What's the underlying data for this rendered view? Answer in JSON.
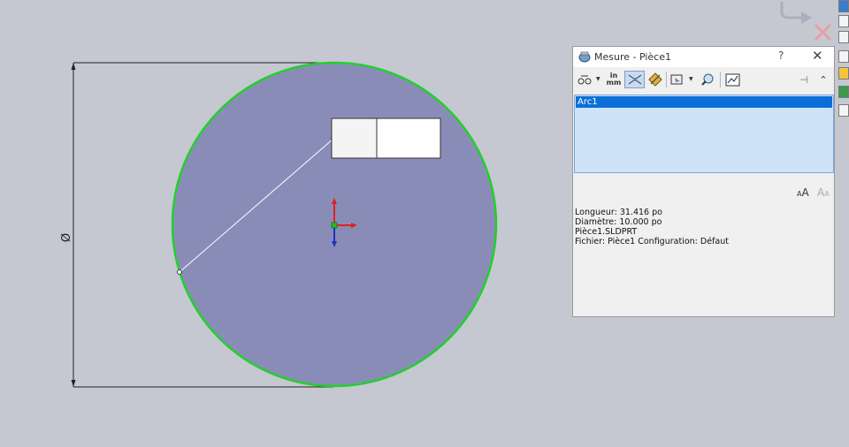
{
  "sketch": {
    "dimension_symbol": "Ø",
    "dimension_value": "",
    "entity_color": "#22d02a",
    "fill_color": "#8a8cb8"
  },
  "measure_dialog": {
    "title": "Mesure - Pièce1",
    "help_label": "?",
    "close_label": "✕",
    "units_label_top": "in",
    "units_label_bottom": "mm",
    "selection_items": [
      "Arc1"
    ],
    "results": {
      "length": "Longueur: 31.416 po",
      "diameter": "Diamètre: 10.000 po",
      "file_name": "Pièce1.SLDPRT",
      "file_config": "Fichier: Pièce1 Configuration: Défaut"
    }
  },
  "icons": {
    "arc_options": "arc-circle-options-icon",
    "units": "units-precision-icon",
    "show_xyz": "show-xyz-measurements-icon",
    "point_to_point": "point-to-point-icon",
    "projection": "projection-icon",
    "history": "measure-history-icon",
    "sensor": "create-sensor-icon",
    "pin": "pin-icon",
    "collapse": "collapse-icon",
    "larger_text": "larger-font-icon",
    "smaller_text": "smaller-font-icon",
    "confirm_corner_rotate": "rotate-arrow-icon",
    "cancel_corner": "cancel-x-icon"
  }
}
